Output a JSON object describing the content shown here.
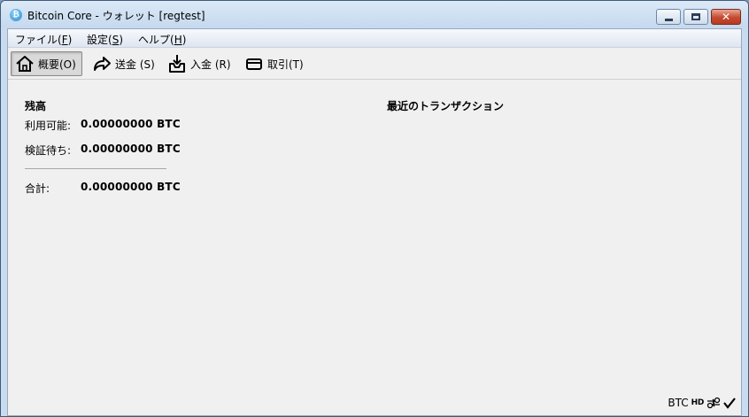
{
  "window": {
    "title": "Bitcoin Core - ウォレット [regtest]",
    "app_icon_glyph": "₿"
  },
  "menu": {
    "file": {
      "prefix": "ファイル(",
      "key": "F",
      "suffix": ")"
    },
    "settings": {
      "prefix": "設定(",
      "key": "S",
      "suffix": ")"
    },
    "help": {
      "prefix": "ヘルプ(",
      "key": "H",
      "suffix": ")"
    }
  },
  "toolbar": {
    "overview": "概要(O)",
    "send": "送金 (S)",
    "receive": "入金 (R)",
    "transactions": "取引(T)"
  },
  "balances": {
    "heading": "残高",
    "available_label": "利用可能:",
    "available_value": "0.00000000 BTC",
    "pending_label": "検証待ち:",
    "pending_value": "0.00000000 BTC",
    "total_label": "合計:",
    "total_value": "0.00000000 BTC"
  },
  "recent": {
    "heading": "最近のトランザクション"
  },
  "status": {
    "unit": "BTC",
    "hd": "HD"
  },
  "colors": {
    "title_gradient_top": "#dce9f7",
    "close_button": "#c54a2f",
    "client_bg": "#f0f0f0"
  }
}
